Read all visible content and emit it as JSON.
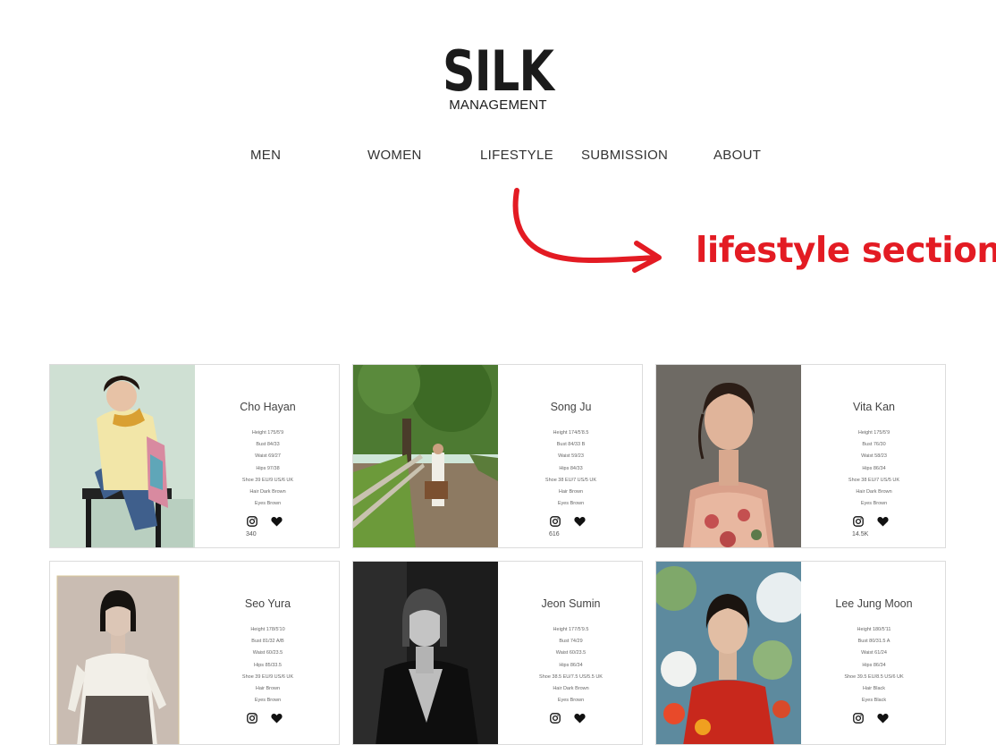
{
  "brand": {
    "name": "SILK",
    "subtitle": "MANAGEMENT"
  },
  "nav": {
    "items": [
      "MEN",
      "WOMEN",
      "LIFESTYLE",
      "SUBMISSION",
      "ABOUT"
    ]
  },
  "annotation": {
    "text": "lifestyle section",
    "color": "#e31b23"
  },
  "models": [
    {
      "name": "Cho Hayan",
      "stats": [
        "Height 175/5'9",
        "Bust 84/33",
        "Waist 69/27",
        "Hips 97/38",
        "Shoe 39 EU/9 US/6 UK",
        "Hair Dark Brown",
        "Eyes Brown"
      ],
      "followers": "340"
    },
    {
      "name": "Song Ju",
      "stats": [
        "Height 174/5'8.5",
        "Bust 84/33  B",
        "Waist 59/23",
        "Hips 84/33",
        "Shoe 38 EU/7 US/5 UK",
        "Hair Brown",
        "Eyes Brown"
      ],
      "followers": "616"
    },
    {
      "name": "Vita Kan",
      "stats": [
        "Height 175/5'9",
        "Bust 76/30",
        "Waist 58/23",
        "Hips 86/34",
        "Shoe 38 EU/7 US/5 UK",
        "Hair Dark Brown",
        "Eyes Brown"
      ],
      "followers": "14.5K"
    },
    {
      "name": "Seo Yura",
      "stats": [
        "Height 178/5'10",
        "Bust 81/32  A/B",
        "Waist 60/23.5",
        "Hips 85/33.5",
        "Shoe 39 EU/9 US/6 UK",
        "Hair Brown",
        "Eyes Brown"
      ],
      "followers": ""
    },
    {
      "name": "Jeon Sumin",
      "stats": [
        "Height 177/5'9.5",
        "Bust 74/29",
        "Waist 60/23.5",
        "Hips 86/34",
        "Shoe 38.5 EU/7.5 US/5.5 UK",
        "Hair Dark Brown",
        "Eyes Brown"
      ],
      "followers": ""
    },
    {
      "name": "Lee Jung Moon",
      "stats": [
        "Height 180/5'11",
        "Bust 80/31.5  A",
        "Waist 61/24",
        "Hips 86/34",
        "Shoe 39.5 EU/8.5 US/6 UK",
        "Hair Black",
        "Eyes Black"
      ],
      "followers": ""
    }
  ]
}
